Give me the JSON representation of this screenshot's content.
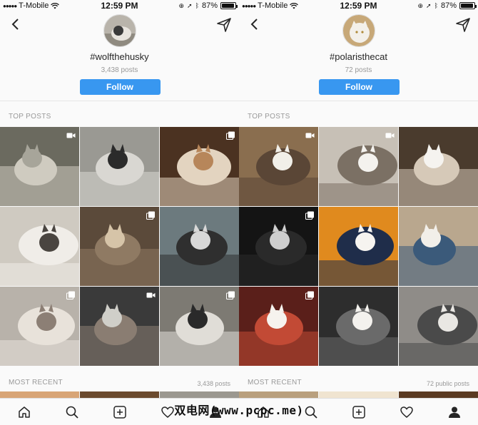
{
  "status_bar": {
    "carrier": "T-Mobile",
    "time": "12:59 PM",
    "battery": "87%",
    "battery_level": 0.87
  },
  "screens": [
    {
      "hashtag": "#wolfthehusky",
      "posts": "3,438 posts",
      "follow_label": "Follow",
      "top_posts_label": "TOP POSTS",
      "most_recent_label": "MOST RECENT",
      "recent_count": "3,438 posts",
      "tiles": [
        {
          "badge": "video-icon",
          "colors": [
            "#6b6a5f",
            "#a7a59a",
            "#cfcbc0"
          ]
        },
        {
          "badge": "",
          "colors": [
            "#9a9993",
            "#2b2b2b",
            "#d9d7d2"
          ]
        },
        {
          "badge": "multiple-icon",
          "colors": [
            "#4b3221",
            "#b7865a",
            "#e3d4c0"
          ]
        },
        {
          "badge": "",
          "colors": [
            "#cfcac1",
            "#4a4540",
            "#f0ede8"
          ]
        },
        {
          "badge": "multiple-icon",
          "colors": [
            "#5b4a3a",
            "#d6c4a8",
            "#8f7a63"
          ]
        },
        {
          "badge": "",
          "colors": [
            "#6c7a7e",
            "#d8d8d8",
            "#2f2f2f"
          ]
        },
        {
          "badge": "multiple-icon",
          "colors": [
            "#b8b2aa",
            "#8c7f75",
            "#e8e2da"
          ]
        },
        {
          "badge": "video-icon",
          "colors": [
            "#3a3a3a",
            "#d0cfc9",
            "#8a7d72"
          ]
        },
        {
          "badge": "multiple-icon",
          "colors": [
            "#7d7a73",
            "#2a2a2a",
            "#e0ddd7"
          ]
        }
      ],
      "recent_colors": [
        "#d8a577",
        "#6b4a2e",
        "#9b9890"
      ]
    },
    {
      "hashtag": "#polaristhecat",
      "posts": "72 posts",
      "follow_label": "Follow",
      "top_posts_label": "TOP POSTS",
      "most_recent_label": "MOST RECENT",
      "recent_count": "72 public posts",
      "tiles": [
        {
          "badge": "video-icon",
          "colors": [
            "#8a6e4f",
            "#f1efe9",
            "#5a4636"
          ]
        },
        {
          "badge": "video-icon",
          "colors": [
            "#c7c0b6",
            "#f4f2ee",
            "#7b7064"
          ]
        },
        {
          "badge": "",
          "colors": [
            "#4a3b2d",
            "#f5f3ef",
            "#d6c9b8"
          ]
        },
        {
          "badge": "multiple-icon",
          "colors": [
            "#141414",
            "#cfcfcf",
            "#2a2a2a"
          ]
        },
        {
          "badge": "",
          "colors": [
            "#e08a1e",
            "#f6f4f0",
            "#1f2d4a"
          ]
        },
        {
          "badge": "",
          "colors": [
            "#b9a78e",
            "#f2efe9",
            "#3b5a7a"
          ]
        },
        {
          "badge": "multiple-icon",
          "colors": [
            "#5a1f1a",
            "#f6f3ee",
            "#c24a35"
          ]
        },
        {
          "badge": "",
          "colors": [
            "#2d2d2d",
            "#f4f2ee",
            "#6a6a6a"
          ]
        },
        {
          "badge": "",
          "colors": [
            "#8f8c88",
            "#e9e7e3",
            "#4a4a4a"
          ]
        }
      ],
      "recent_colors": [
        "#b9a07e",
        "#f0e4d0",
        "#5b3b22"
      ]
    }
  ],
  "tabs": [
    {
      "icon": "home-icon"
    },
    {
      "icon": "search-icon"
    },
    {
      "icon": "add-post-icon"
    },
    {
      "icon": "heart-icon"
    },
    {
      "icon": "profile-icon"
    }
  ],
  "watermark": "双电网(www.pcpc.me)",
  "accent_color": "#3897f0"
}
